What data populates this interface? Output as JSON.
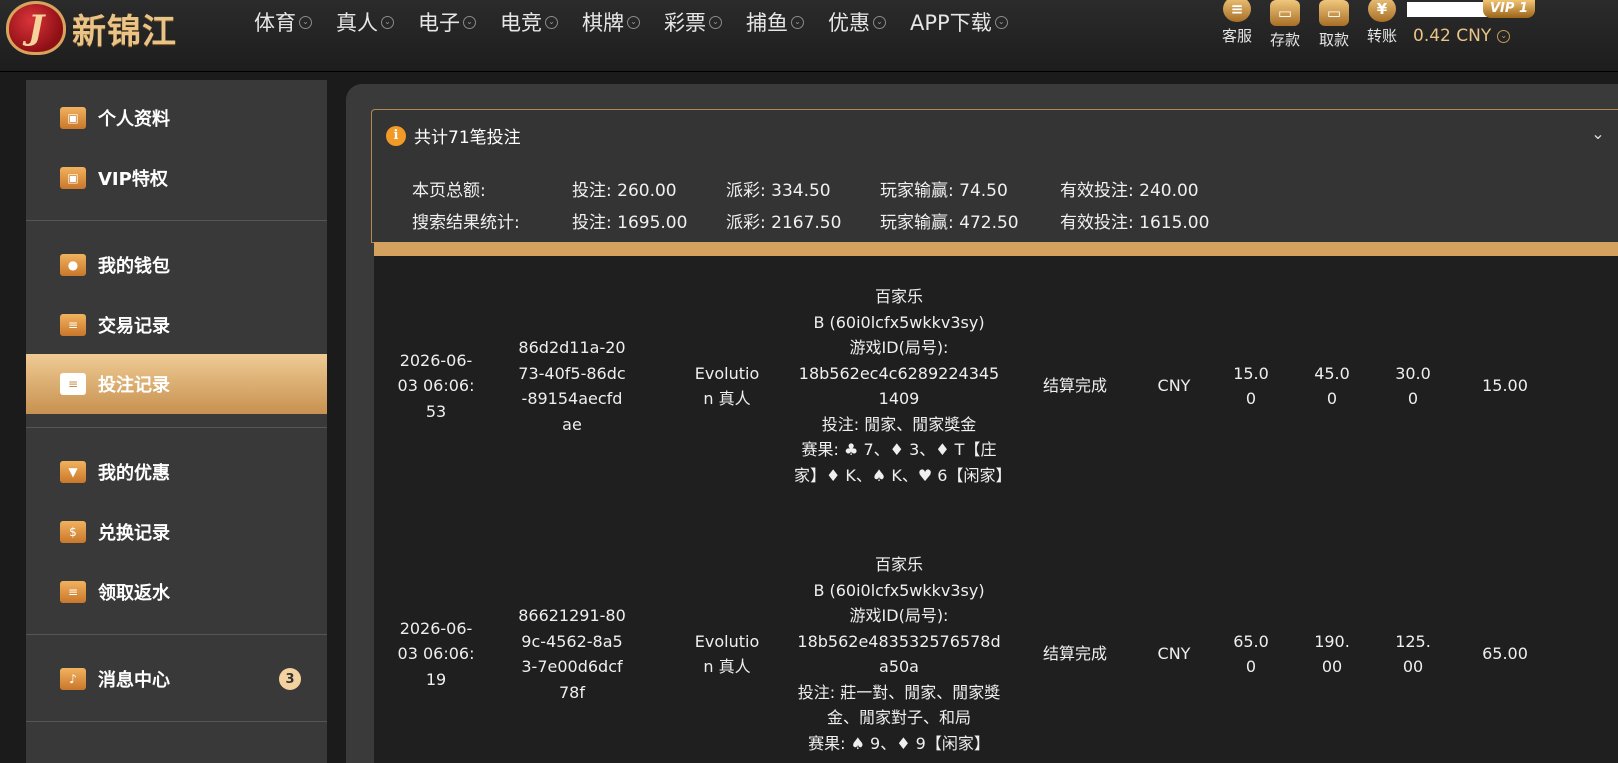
{
  "header": {
    "logo_text": "新锦江",
    "logo_badge": "J",
    "nav": [
      "体育",
      "真人",
      "电子",
      "电竞",
      "棋牌",
      "彩票",
      "捕鱼",
      "优惠",
      "APP下载"
    ],
    "actions": [
      {
        "label": "客服",
        "icon": "customer-service-icon",
        "glyph": "≡"
      },
      {
        "label": "存款",
        "icon": "deposit-card-icon",
        "glyph": "▭"
      },
      {
        "label": "取款",
        "icon": "withdraw-card-icon",
        "glyph": "▭"
      },
      {
        "label": "转账",
        "icon": "transfer-yuan-icon",
        "glyph": "¥"
      }
    ],
    "vip": "VIP 1",
    "balance": "0.42 CNY"
  },
  "sidebar": {
    "items": [
      {
        "label": "个人资料",
        "icon": "id-card-icon",
        "glyph": "▣"
      },
      {
        "label": "VIP特权",
        "icon": "vip-card-icon",
        "glyph": "▣"
      },
      {
        "label": "我的钱包",
        "icon": "piggy-bank-icon",
        "glyph": "●"
      },
      {
        "label": "交易记录",
        "icon": "document-icon",
        "glyph": "≡"
      },
      {
        "label": "投注记录",
        "icon": "bet-record-icon",
        "glyph": "≡"
      },
      {
        "label": "我的优惠",
        "icon": "gift-bag-icon",
        "glyph": "▼"
      },
      {
        "label": "兑换记录",
        "icon": "money-bag-icon",
        "glyph": "$"
      },
      {
        "label": "领取返水",
        "icon": "rebate-doc-icon",
        "glyph": "≡"
      },
      {
        "label": "消息中心",
        "icon": "bell-icon",
        "glyph": "♪"
      }
    ],
    "active": "投注记录",
    "message_count": "3"
  },
  "summary": {
    "title": "共计71笔投注",
    "page_label": "本页总额:",
    "page_bet": "投注: 260.00",
    "page_payout": "派彩: 334.50",
    "page_winloss": "玩家输赢: 74.50",
    "page_valid": "有效投注: 240.00",
    "search_label": "搜索结果统计:",
    "search_bet": "投注: 1695.00",
    "search_payout": "派彩: 2167.50",
    "search_winloss": "玩家输赢: 472.50",
    "search_valid": "有效投注: 1615.00"
  },
  "records": [
    {
      "time": "2026-06-03 06:06:53",
      "order_id": "86d2d11a-2073-40f5-86dc-89154aecfdae",
      "platform": "Evolution 真人",
      "detail": "百家乐\nB (60i0lcfx5wkkv3sy)\n游戏ID(局号):\n18b562ec4c62892243451409\n投注: 閒家、閒家獎金\n赛果: ♣ 7、♦ 3、♦ T【庄家】♦ K、♠ K、♥ 6【闲家】",
      "status": "结算完成",
      "currency": "CNY",
      "bet": "15.00",
      "payout": "45.00",
      "winloss": "30.00",
      "valid": "15.00"
    },
    {
      "time": "2026-06-03 06:06:19",
      "order_id": "86621291-809c-4562-8a53-7e00d6dcf78f",
      "platform": "Evolution 真人",
      "detail": "百家乐\nB (60i0lcfx5wkkv3sy)\n游戏ID(局号):\n18b562e483532576578da50a\n投注: 莊一對、閒家、閒家獎金、閒家對子、和局\n赛果: ♠ 9、♦ 9【闲家】",
      "status": "结算完成",
      "currency": "CNY",
      "bet": "65.00",
      "payout": "190.00",
      "winloss": "125.00",
      "valid": "65.00"
    }
  ]
}
